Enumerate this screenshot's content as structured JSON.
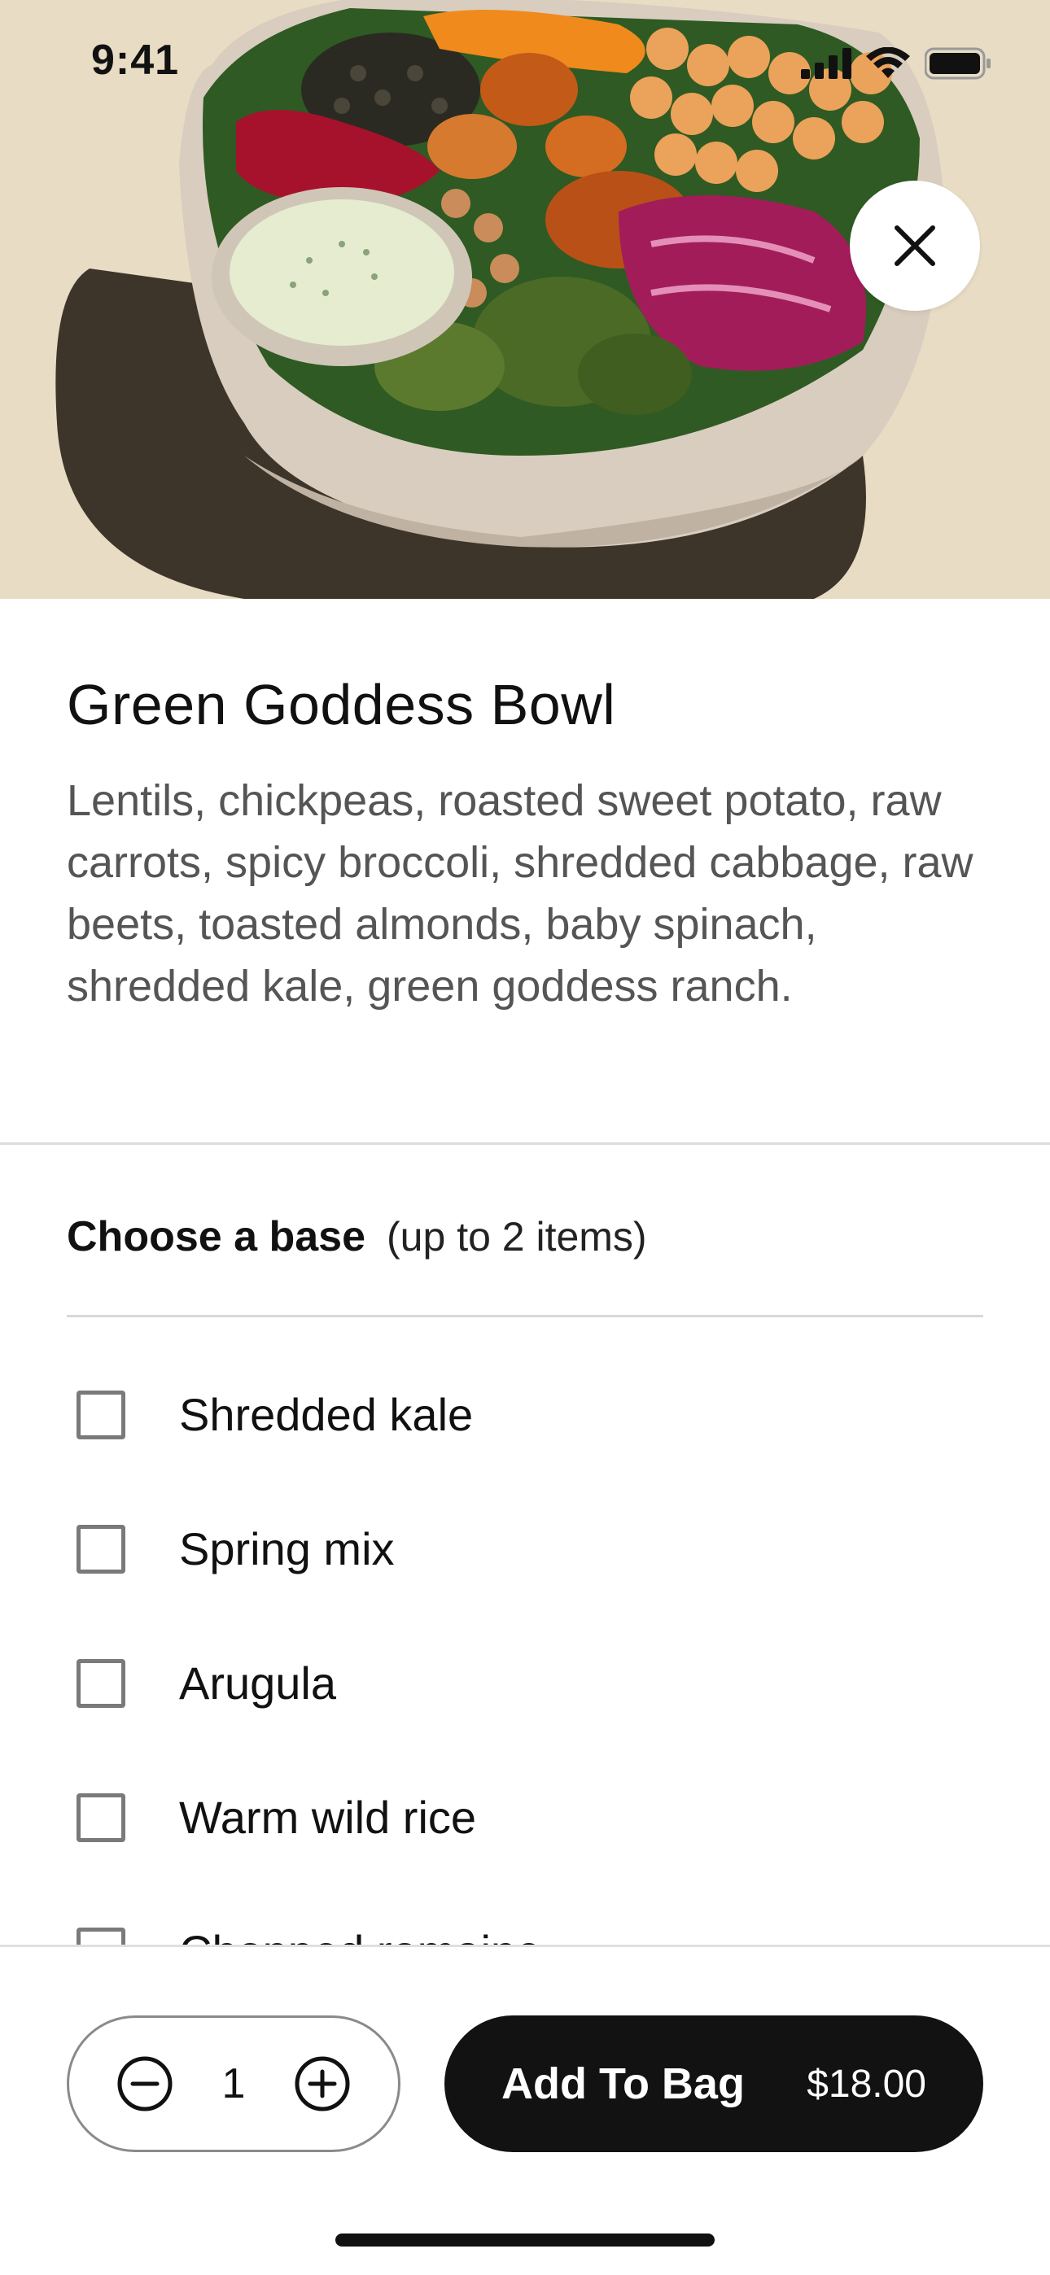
{
  "status_bar": {
    "time": "9:41",
    "icons": [
      "signal-icon",
      "wifi-icon",
      "battery-icon"
    ]
  },
  "hero": {
    "icon": "food-bowl-image",
    "close_icon": "close-icon"
  },
  "product": {
    "title": "Green Goddess Bowl",
    "description": "Lentils, chickpeas, roasted sweet potato, raw carrots, spicy broccoli, shredded cabbage, raw beets, toasted almonds, baby spinach, shredded kale, green goddess ranch."
  },
  "options": {
    "title": "Choose a base",
    "limit": "(up to 2 items)",
    "items": [
      {
        "label": "Shredded kale",
        "checked": false
      },
      {
        "label": "Spring mix",
        "checked": false
      },
      {
        "label": "Arugula",
        "checked": false
      },
      {
        "label": "Warm wild rice",
        "checked": false
      },
      {
        "label": "Chopped romaine",
        "checked": false
      }
    ]
  },
  "footer": {
    "quantity": "1",
    "decrement_icon": "minus-circle-icon",
    "increment_icon": "plus-circle-icon",
    "add_label": "Add To Bag",
    "price": "$18.00"
  },
  "colors": {
    "hero_background": "#e8dcc4",
    "button_dark": "#121212",
    "description_text": "#555555",
    "divider": "#dcdcdc"
  }
}
